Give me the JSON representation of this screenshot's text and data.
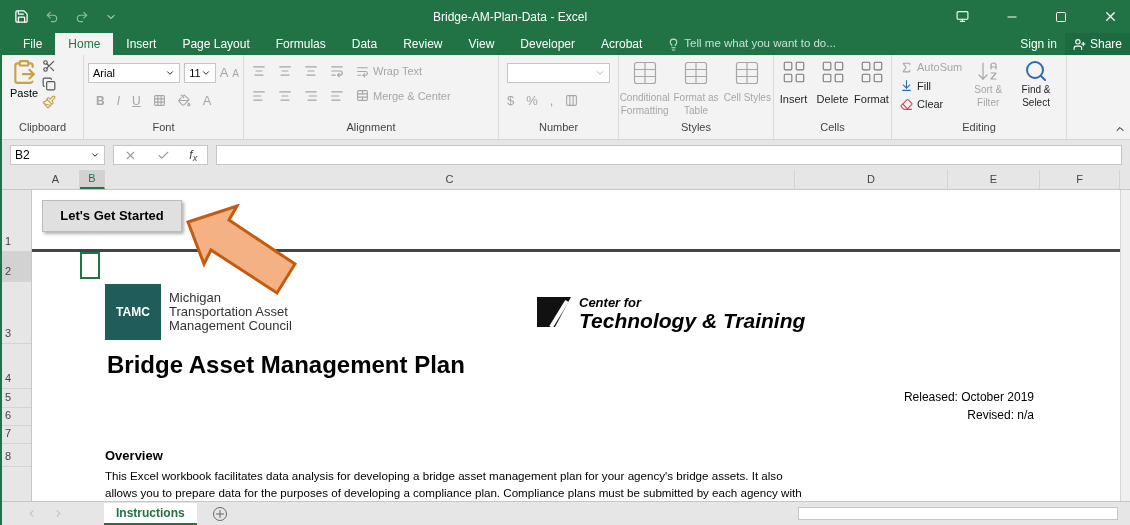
{
  "window": {
    "title": "Bridge-AM-Plan-Data - Excel"
  },
  "ribbon_tabs": [
    {
      "label": "File",
      "selected": false
    },
    {
      "label": "Home",
      "selected": true
    },
    {
      "label": "Insert",
      "selected": false
    },
    {
      "label": "Page Layout",
      "selected": false
    },
    {
      "label": "Formulas",
      "selected": false
    },
    {
      "label": "Data",
      "selected": false
    },
    {
      "label": "Review",
      "selected": false
    },
    {
      "label": "View",
      "selected": false
    },
    {
      "label": "Developer",
      "selected": false
    },
    {
      "label": "Acrobat",
      "selected": false
    }
  ],
  "tell_me": {
    "placeholder": "Tell me what you want to do..."
  },
  "account": {
    "sign_in": "Sign in",
    "share": "Share"
  },
  "clipboard": {
    "label": "Clipboard",
    "paste": "Paste"
  },
  "font": {
    "label": "Font",
    "name": "Arial",
    "size": "11",
    "grow": "A",
    "shrink": "A",
    "font_color_letter": "A",
    "styles": [
      {
        "label": "B",
        "disabled": true
      },
      {
        "label": "I",
        "disabled": true
      },
      {
        "label": "U",
        "disabled": true
      }
    ]
  },
  "alignment": {
    "label": "Alignment",
    "wrap_text": {
      "label": "Wrap Text",
      "disabled": true
    },
    "merge_center": {
      "label": "Merge & Center",
      "disabled": true
    }
  },
  "number": {
    "label": "Number",
    "symbols": [
      {
        "label": "$",
        "disabled": true
      },
      {
        "label": "%",
        "disabled": true
      },
      {
        "label": ",",
        "disabled": true
      }
    ]
  },
  "styles": {
    "label": "Styles",
    "buttons": [
      {
        "label": "Conditional Formatting",
        "disabled": true
      },
      {
        "label": "Format as Table",
        "disabled": true
      },
      {
        "label": "Cell Styles",
        "disabled": true
      }
    ]
  },
  "cells": {
    "label": "Cells",
    "buttons": [
      {
        "label": "Insert",
        "disabled": false
      },
      {
        "label": "Delete",
        "disabled": false
      },
      {
        "label": "Format",
        "disabled": false
      }
    ]
  },
  "editing": {
    "label": "Editing",
    "autosum": {
      "label": "AutoSum",
      "disabled": true
    },
    "fill": {
      "label": "Fill",
      "disabled": false
    },
    "clear": {
      "label": "Clear",
      "disabled": false
    },
    "sort_filter": {
      "label": "Sort & Filter",
      "disabled": true
    },
    "find_select": {
      "label": "Find & Select",
      "disabled": false
    }
  },
  "formula_bar": {
    "name_box": "B2",
    "function_label": "f$_{x}$"
  },
  "columns": [
    {
      "label": "A",
      "selected": false
    },
    {
      "label": "B",
      "selected": true
    },
    {
      "label": "C",
      "selected": false
    },
    {
      "label": "D",
      "selected": false
    },
    {
      "label": "E",
      "selected": false
    },
    {
      "label": "F",
      "selected": false
    }
  ],
  "rows": [
    "1",
    "2",
    "3",
    "4",
    "5",
    "6",
    "7",
    "8"
  ],
  "sheet": {
    "start_button": "Let's Get Started",
    "tamc_logo": {
      "badge": "TAMC",
      "lines": [
        "Michigan",
        "Transportation Asset",
        "Management Council"
      ]
    },
    "ctt_logo": {
      "lines": [
        "Center for",
        "Technology & Training"
      ]
    },
    "heading": "Bridge Asset Management Plan",
    "released": "Released: October 2019",
    "revised": "Revised: n/a",
    "overview_title": "Overview",
    "overview_text": "This Excel workbook facilitates data analysis for developing a bridge asset management plan for your agency's bridge assets. It also allows you to prepare data for the purposes of developing a compliance plan. Compliance plans must be submitted by each agency with"
  },
  "sheet_tabs": [
    {
      "label": "Instructions",
      "selected": true
    }
  ]
}
